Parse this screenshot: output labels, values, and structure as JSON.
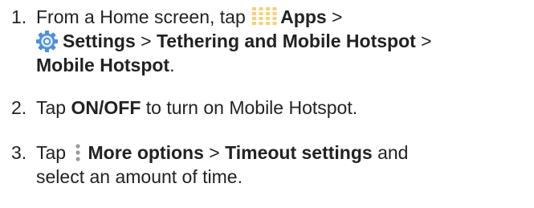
{
  "steps": [
    {
      "number": "1.",
      "segments": {
        "t1": "From a Home screen, tap ",
        "apps": "Apps",
        "sep1": " >",
        "settings": "Settings",
        "sep2": " > ",
        "tethering": "Tethering and Mobile Hotspot",
        "sep3": " >",
        "hotspot": "Mobile Hotspot",
        "end": "."
      },
      "icons": [
        "apps-grid-icon",
        "settings-gear-icon"
      ]
    },
    {
      "number": "2.",
      "segments": {
        "t1": "Tap ",
        "onoff": "ON/OFF",
        "t2": " to turn on Mobile Hotspot."
      }
    },
    {
      "number": "3.",
      "segments": {
        "t1": "Tap ",
        "more": "More options",
        "sep1": " > ",
        "timeout": "Timeout settings",
        "t2": " and",
        "t3": "select an amount of time."
      },
      "icons": [
        "more-options-icon"
      ]
    }
  ],
  "colors": {
    "text": "#222222",
    "icon_grid": "#f4d27a",
    "gear_outer": "#4f8fd6",
    "gear_inner": "#d8ecff",
    "more_dots": "#9a9a9a"
  }
}
